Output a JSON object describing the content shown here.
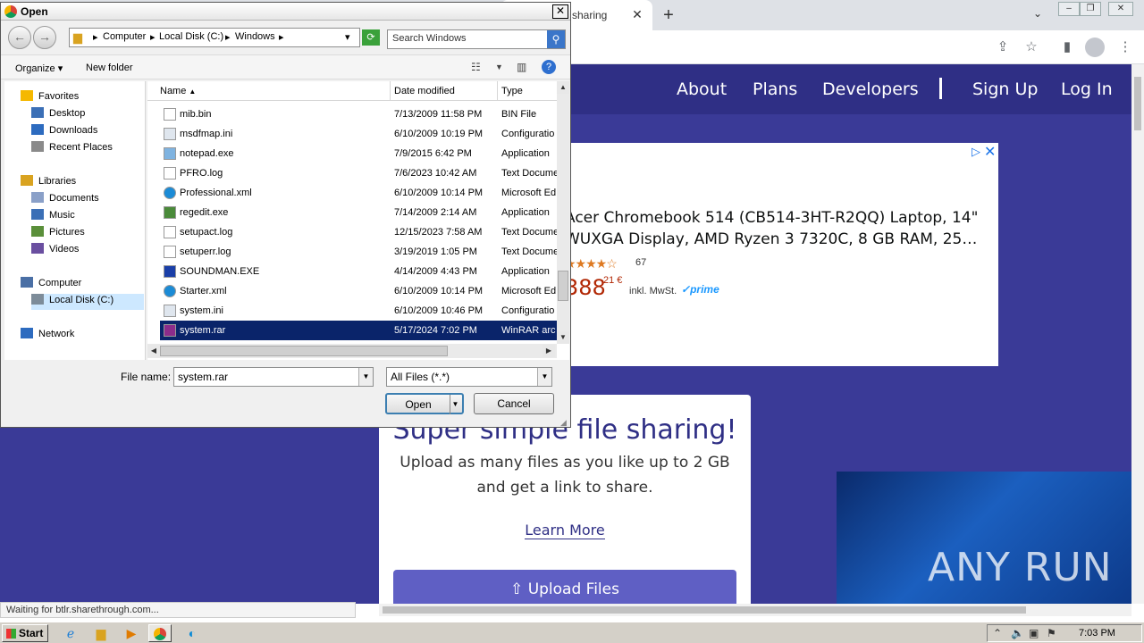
{
  "browser": {
    "tab_title": "sharing",
    "status_text": "Waiting for btlr.sharethrough.com..."
  },
  "site": {
    "nav": [
      "About",
      "Plans",
      "Developers",
      "Sign Up",
      "Log In"
    ],
    "ad": {
      "title": "Acer Chromebook 514 (CB514-3HT-R2QQ) Laptop, 14\" WUXGA Display, AMD Ryzen 3 7320C, 8 GB RAM, 25…",
      "rating_count": "67",
      "price_main": "388",
      "price_cents": "21 €",
      "tax_note": "inkl. MwSt.",
      "prime": "prime"
    },
    "card": {
      "title": "Super simple file sharing!",
      "description": "Upload as many files as you like up to 2 GB and get a link to share.",
      "learn_more": "Learn More",
      "upload_button": "Upload Files"
    },
    "watermark": "ANY RUN"
  },
  "dialog": {
    "title": "Open",
    "breadcrumb": [
      "Computer",
      "Local Disk (C:)",
      "Windows"
    ],
    "search_placeholder": "Search Windows",
    "organize": "Organize",
    "new_folder": "New folder",
    "nav_pane": [
      {
        "label": "Favorites",
        "icon": "star-icon",
        "indent": 0
      },
      {
        "label": "Desktop",
        "icon": "desktop-icon",
        "indent": 1
      },
      {
        "label": "Downloads",
        "icon": "downloads-icon",
        "indent": 1
      },
      {
        "label": "Recent Places",
        "icon": "recent-places-icon",
        "indent": 1
      },
      {
        "label": "Libraries",
        "icon": "libraries-icon",
        "indent": 0
      },
      {
        "label": "Documents",
        "icon": "documents-icon",
        "indent": 1
      },
      {
        "label": "Music",
        "icon": "music-icon",
        "indent": 1
      },
      {
        "label": "Pictures",
        "icon": "pictures-icon",
        "indent": 1
      },
      {
        "label": "Videos",
        "icon": "videos-icon",
        "indent": 1
      },
      {
        "label": "Computer",
        "icon": "computer-icon",
        "indent": 0
      },
      {
        "label": "Local Disk (C:)",
        "icon": "drive-icon",
        "indent": 1,
        "selected": true
      },
      {
        "label": "Network",
        "icon": "network-icon",
        "indent": 0
      }
    ],
    "columns": {
      "name": "Name",
      "date": "Date modified",
      "type": "Type"
    },
    "files": [
      {
        "name": "mib.bin",
        "date": "7/13/2009 11:58 PM",
        "type": "BIN File",
        "icon": "file-icon"
      },
      {
        "name": "msdfmap.ini",
        "date": "6/10/2009 10:19 PM",
        "type": "Configuratio",
        "icon": "config-file-icon"
      },
      {
        "name": "notepad.exe",
        "date": "7/9/2015 6:42 PM",
        "type": "Application",
        "icon": "notepad-icon"
      },
      {
        "name": "PFRO.log",
        "date": "7/6/2023 10:42 AM",
        "type": "Text Docume",
        "icon": "text-file-icon"
      },
      {
        "name": "Professional.xml",
        "date": "6/10/2009 10:14 PM",
        "type": "Microsoft Ed",
        "icon": "edge-icon"
      },
      {
        "name": "regedit.exe",
        "date": "7/14/2009 2:14 AM",
        "type": "Application",
        "icon": "regedit-icon"
      },
      {
        "name": "setupact.log",
        "date": "12/15/2023 7:58 AM",
        "type": "Text Docume",
        "icon": "text-file-icon"
      },
      {
        "name": "setuperr.log",
        "date": "3/19/2019 1:05 PM",
        "type": "Text Docume",
        "icon": "text-file-icon"
      },
      {
        "name": "SOUNDMAN.EXE",
        "date": "4/14/2009 4:43 PM",
        "type": "Application",
        "icon": "soundman-icon"
      },
      {
        "name": "Starter.xml",
        "date": "6/10/2009 10:14 PM",
        "type": "Microsoft Ed",
        "icon": "edge-icon"
      },
      {
        "name": "system.ini",
        "date": "6/10/2009 10:46 PM",
        "type": "Configuratio",
        "icon": "config-file-icon"
      },
      {
        "name": "system.rar",
        "date": "5/17/2024 7:02 PM",
        "type": "WinRAR arc",
        "icon": "winrar-icon",
        "selected": true
      }
    ],
    "file_name_label": "File name:",
    "file_name_value": "system.rar",
    "filter_value": "All Files (*.*)",
    "open_button": "Open",
    "cancel_button": "Cancel"
  },
  "taskbar": {
    "start_label": "Start",
    "apps": [
      "ie-icon",
      "explorer-icon",
      "media-player-icon",
      "chrome-icon",
      "edge-icon"
    ],
    "clock": "7:03 PM"
  },
  "colors": {
    "site_bg": "#3a3a97",
    "site_nav": "#2f2f85",
    "upload_button": "#5f5fc4",
    "selection": "#0a246a"
  }
}
